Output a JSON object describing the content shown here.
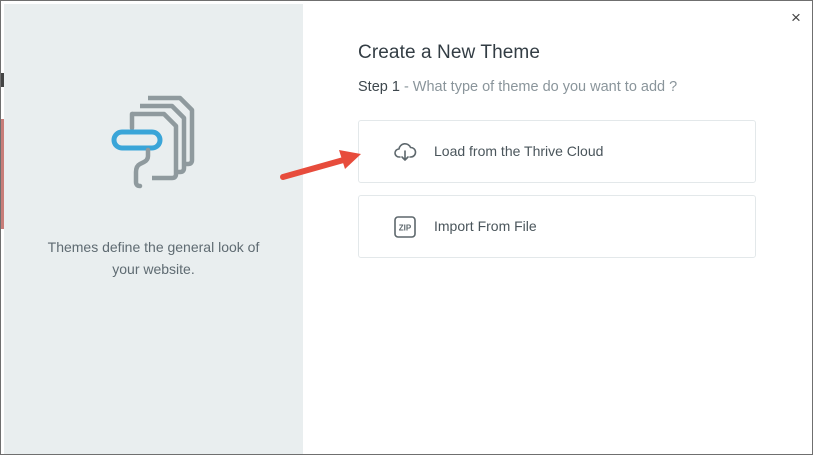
{
  "dialog": {
    "title": "Create a New Theme",
    "step_number": "Step 1",
    "step_question": "- What type of theme do you want to add ?",
    "close_glyph": "×"
  },
  "left_panel": {
    "caption": "Themes define the general look of your website.",
    "illustration_icon": "theme-pages-icon"
  },
  "options": [
    {
      "label": "Load from the Thrive Cloud",
      "icon": "cloud-download-icon"
    },
    {
      "label": "Import From File",
      "icon": "zip-file-icon",
      "icon_text": "ZIP"
    }
  ],
  "colors": {
    "left_panel_bg": "#e9eeef",
    "accent_blue": "#3aa5d8",
    "illustration_gray": "#8f9a9e",
    "arrow_red": "#e74c3c"
  }
}
